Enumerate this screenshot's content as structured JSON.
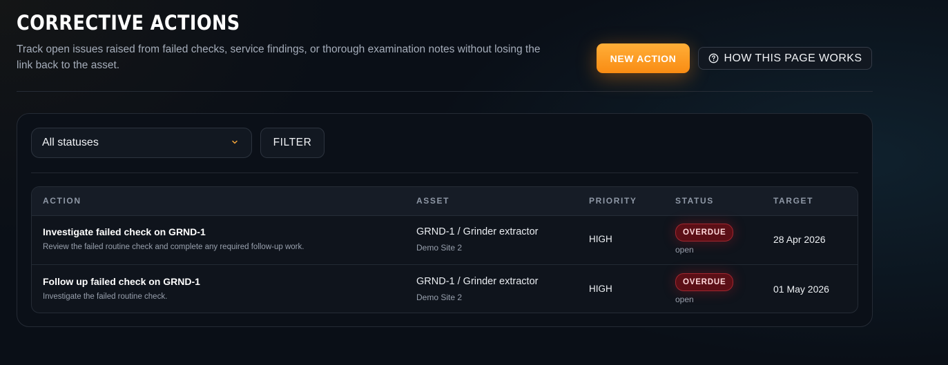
{
  "header": {
    "title": "CORRECTIVE ACTIONS",
    "subtitle": "Track open issues raised from failed checks, service findings, or thorough examination notes without losing the link back to the asset.",
    "new_action_label": "NEW ACTION",
    "how_label": "HOW THIS PAGE WORKS",
    "how_icon": "question-circle-icon"
  },
  "filters": {
    "status_select_value": "All statuses",
    "status_select_icon": "chevron-down-icon",
    "filter_label": "FILTER"
  },
  "table": {
    "columns": [
      "ACTION",
      "ASSET",
      "PRIORITY",
      "STATUS",
      "TARGET"
    ],
    "rows": [
      {
        "title": "Investigate failed check on GRND-1",
        "description": "Review the failed routine check and complete any required follow-up work.",
        "asset": "GRND-1 / Grinder extractor",
        "site": "Demo Site 2",
        "priority": "HIGH",
        "badge": "OVERDUE",
        "state": "open",
        "target": "28 Apr 2026"
      },
      {
        "title": "Follow up failed check on GRND-1",
        "description": "Investigate the failed routine check.",
        "asset": "GRND-1 / Grinder extractor",
        "site": "Demo Site 2",
        "priority": "HIGH",
        "badge": "OVERDUE",
        "state": "open",
        "target": "01 May 2026"
      }
    ]
  },
  "colors": {
    "accent": "#f98c13",
    "overdue_badge": "#5b0f16",
    "background": "#0a0f17"
  }
}
